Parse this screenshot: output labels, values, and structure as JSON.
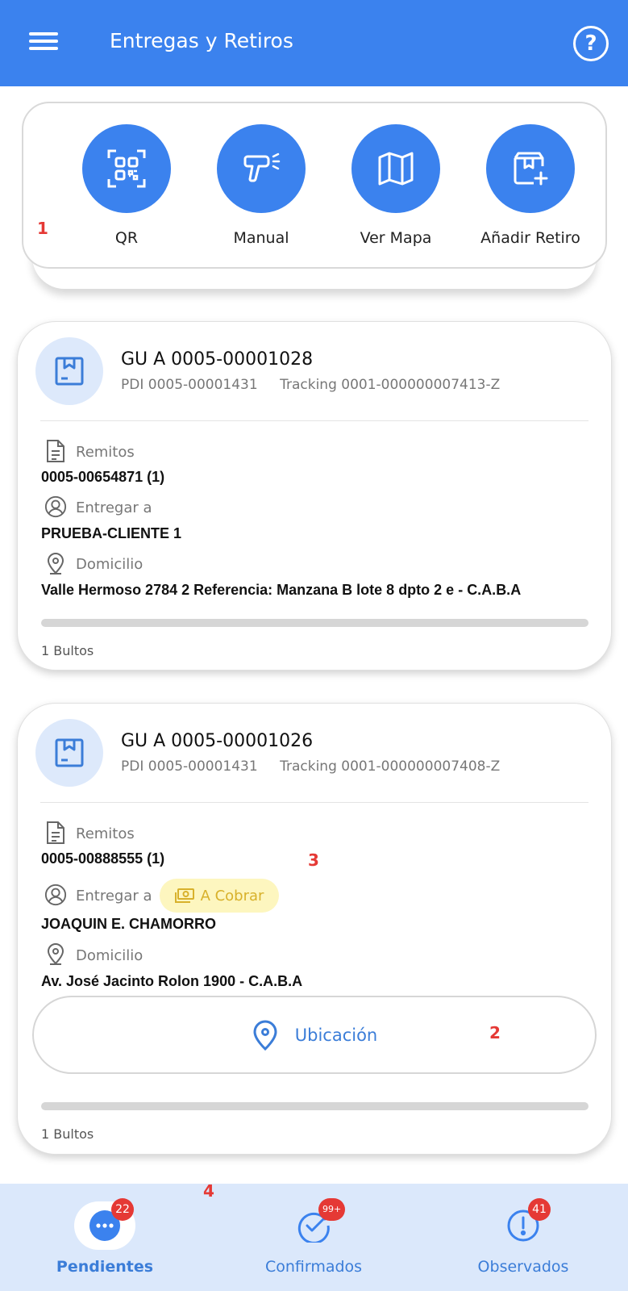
{
  "appbar": {
    "title": "Entregas y Retiros",
    "help_icon": "help-circle-icon",
    "menu_icon": "hamburger-menu-icon"
  },
  "actions": [
    {
      "label": "QR",
      "icon": "qr-code-icon"
    },
    {
      "label": "Manual",
      "icon": "barcode-scanner-icon"
    },
    {
      "label": "Ver Mapa",
      "icon": "map-icon"
    },
    {
      "label": "Añadir Retiro",
      "icon": "add-package-icon"
    }
  ],
  "annotations": [
    "1",
    "2",
    "3",
    "4"
  ],
  "cards": [
    {
      "title": "GU A 0005-00001028",
      "pdi": "PDI 0005-00001431",
      "tracking": "Tracking 0001-000000007413-Z",
      "remitos_label": "Remitos",
      "remitos_value": "0005-00654871 (1)",
      "entregar_label": "Entregar a",
      "entregar_value": "PRUEBA-CLIENTE 1",
      "domicilio_label": "Domicilio",
      "domicilio_value": "Valle Hermoso 2784 2 Referencia: Manzana B lote 8 dpto 2 e - C.A.B.A",
      "bultos": "1 Bultos"
    },
    {
      "title": "GU A 0005-00001026",
      "pdi": "PDI 0005-00001431",
      "tracking": "Tracking 0001-000000007408-Z",
      "remitos_label": "Remitos",
      "remitos_value": "0005-00888555 (1)",
      "entregar_label": "Entregar a",
      "cobrar_badge": "A Cobrar",
      "entregar_value": "JOAQUIN E. CHAMORRO",
      "domicilio_label": "Domicilio",
      "domicilio_value": "Av. José Jacinto Rolon 1900 - C.A.B.A",
      "ubicacion_label": "Ubicación",
      "bultos": "1 Bultos"
    }
  ],
  "bottomnav": [
    {
      "label": "Pendientes",
      "badge": "22",
      "icon": "more-dots-icon",
      "active": true
    },
    {
      "label": "Confirmados",
      "badge": "99+",
      "icon": "check-circle-icon",
      "active": false
    },
    {
      "label": "Observados",
      "badge": "41",
      "icon": "alert-circle-icon",
      "active": false
    }
  ],
  "colors": {
    "primary": "#3b82ee",
    "badge": "#e53935",
    "nav_bg": "#dbe8fb",
    "cobrar_bg": "#fdf6bf",
    "cobrar_text": "#d8b12b"
  }
}
